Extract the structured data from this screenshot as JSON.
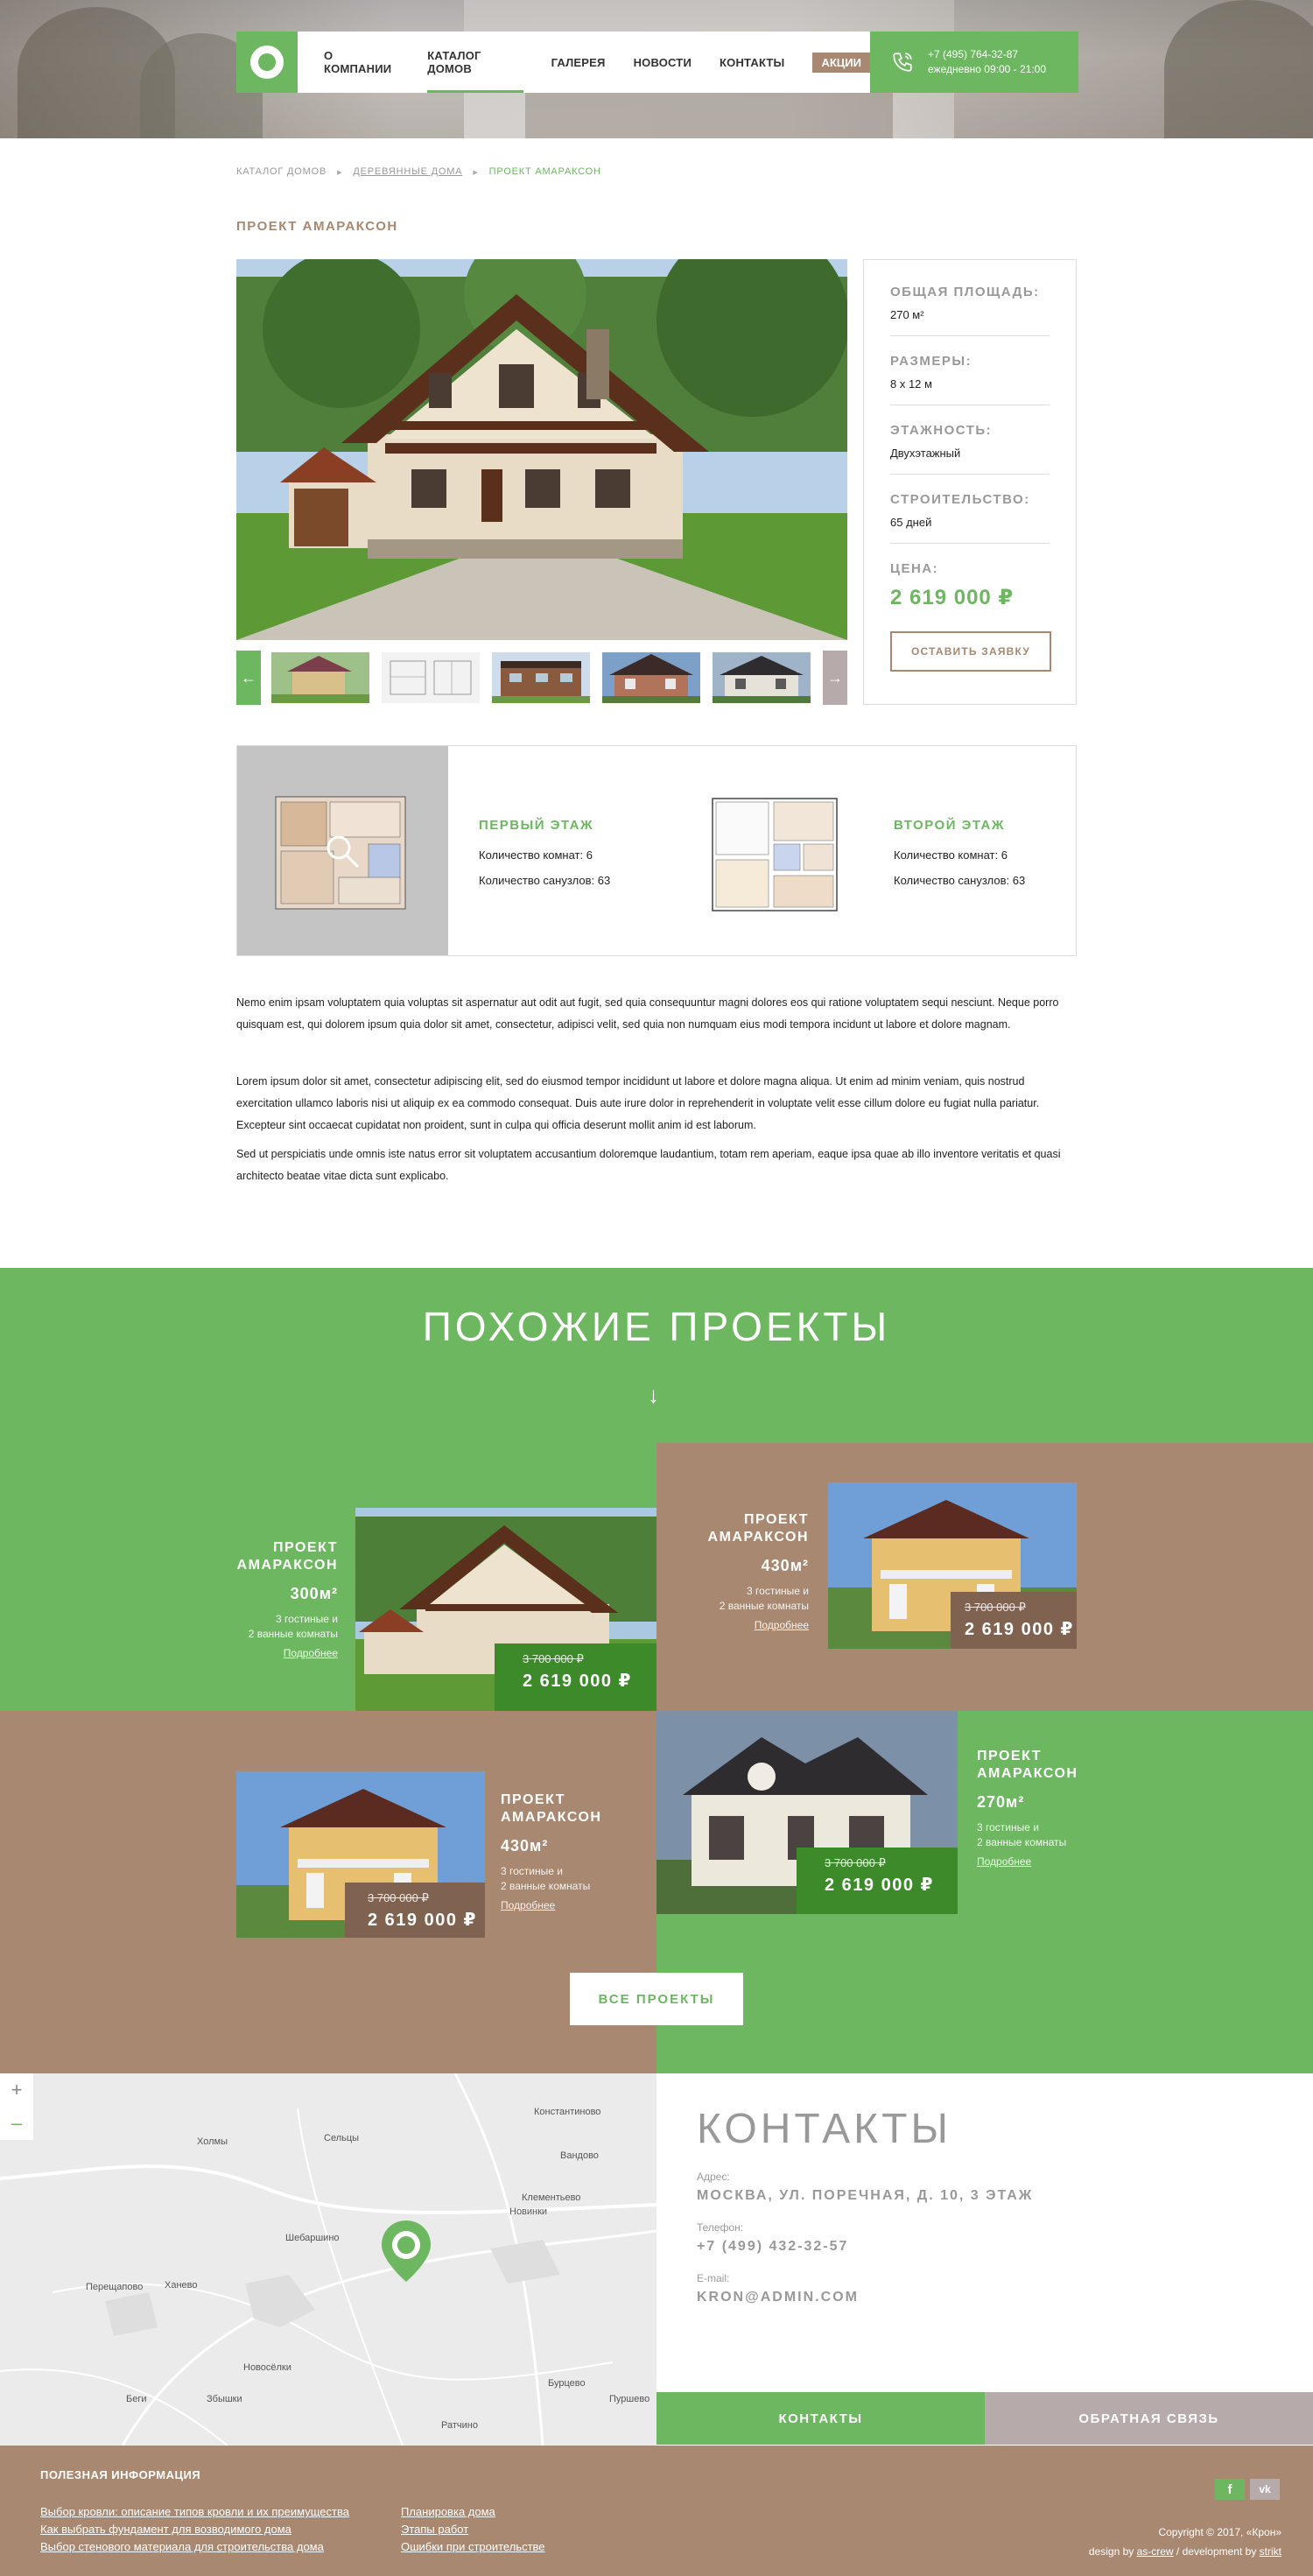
{
  "header": {
    "menu": [
      "О компании",
      "Каталог домов",
      "Галерея",
      "Новости",
      "Контакты"
    ],
    "promo": "Акции",
    "phone": "+7 (495) 764-32-87",
    "hours": "ежедневно 09:00 - 21:00"
  },
  "breadcrumb": {
    "items": [
      "Каталог домов",
      "Деревянные дома",
      "Проект Амараксон"
    ]
  },
  "project": {
    "title": "Проект Амараксон",
    "specs": [
      {
        "label": "Общая площадь:",
        "value": "270 м²"
      },
      {
        "label": "Размеры:",
        "value": "8 х 12 м"
      },
      {
        "label": "Этажность:",
        "value": "Двухэтажный"
      },
      {
        "label": "Строительство:",
        "value": "65 дней"
      }
    ],
    "price_label": "Цена:",
    "price": "2 619 000 ₽",
    "order_button": "Оставить заявку"
  },
  "plans": {
    "floor1": {
      "title": "Первый этаж",
      "rooms": "Количество комнат: 6",
      "baths": "Количество санузлов: 63"
    },
    "floor2": {
      "title": "Второй этаж",
      "rooms": "Количество комнат: 6",
      "baths": "Количество санузлов: 63"
    }
  },
  "description": [
    "Nemo enim ipsam voluptatem quia voluptas sit aspernatur aut odit aut fugit, sed quia consequuntur magni dolores eos qui ratione voluptatem sequi nesciunt. Neque porro quisquam est, qui dolorem ipsum quia dolor sit amet, consectetur, adipisci velit, sed quia non numquam eius modi tempora incidunt ut labore et dolore magnam.",
    "Lorem ipsum dolor sit amet, consectetur adipiscing elit, sed do eiusmod tempor incididunt ut labore et dolore magna aliqua. Ut enim ad minim veniam, quis nostrud exercitation ullamco laboris nisi ut aliquip ex ea commodo consequat. Duis aute irure dolor in reprehenderit in voluptate velit esse cillum dolore eu fugiat nulla pariatur. Excepteur sint occaecat cupidatat non proident, sunt in culpa qui officia deserunt mollit anim id est laborum.",
    "Sed ut perspiciatis unde omnis iste natus error sit voluptatem accusantium doloremque laudantium, totam rem aperiam, eaque ipsa quae ab illo inventore veritatis et quasi architecto beatae vitae dicta sunt explicabo."
  ],
  "similar": {
    "title": "Похожие проекты",
    "cards": [
      {
        "name1": "Проект",
        "name2": "Амараксон",
        "area": "300м²",
        "rooms1": "3 гостиные и",
        "rooms2": "2 ванные комнаты",
        "more": "Подробнее",
        "old_price": "3 700 000 ₽",
        "price": "2 619 000 ₽"
      },
      {
        "name1": "Проект",
        "name2": "Амараксон",
        "area": "430м²",
        "rooms1": "3 гостиные и",
        "rooms2": "2 ванные комнаты",
        "more": "Подробнее",
        "old_price": "3 700 000 ₽",
        "price": "2 619 000 ₽"
      },
      {
        "name1": "Проект",
        "name2": "Амараксон",
        "area": "430м²",
        "rooms1": "3 гостиные и",
        "rooms2": "2 ванные комнаты",
        "more": "Подробнее",
        "old_price": "3 700 000 ₽",
        "price": "2 619 000 ₽"
      },
      {
        "name1": "Проект",
        "name2": "Амараксон",
        "area": "270м²",
        "rooms1": "3 гостиные и",
        "rooms2": "2 ванные комнаты",
        "more": "Подробнее",
        "old_price": "3 700 000 ₽",
        "price": "2 619 000 ₽"
      }
    ],
    "all_button": "Все проекты"
  },
  "map": {
    "labels": [
      "Константиново",
      "Холмы",
      "Сельцы",
      "Вандово",
      "Клементьево",
      "Новинки",
      "Шебаршино",
      "Перещапово",
      "Ханево",
      "Новосёлки",
      "Беги",
      "Збышки",
      "Бурцево",
      "Ратчино",
      "Пуршево"
    ],
    "plus": "+",
    "minus": "–"
  },
  "contacts": {
    "title": "Контакты",
    "address_label": "Адрес:",
    "address": "Москва, ул. Поречная, д. 10, 3 этаж",
    "phone_label": "Телефон:",
    "phone": "+7 (499) 432-32-57",
    "email_label": "E-mail:",
    "email": "kron@admin.com",
    "btn_contacts": "Контакты",
    "btn_feedback": "Обратная связь"
  },
  "footer": {
    "heading": "Полезная информация",
    "col1": [
      "Выбор кровли: описание типов кровли и их преимущества",
      "Как выбрать фундамент для возводимого дома",
      "Выбор стенового материала для строительства дома"
    ],
    "col2": [
      "Планировка дома",
      "Этапы работ",
      "Ошибки при строительстве"
    ],
    "facebook": "f",
    "vk": "vk",
    "copyright": "Copyright ©  2017, «Крон»",
    "design_prefix": "design by ",
    "design_by": "as-crew",
    "dev_prefix": " / development by ",
    "dev_by": "strikt"
  },
  "colors": {
    "accent": "#6cb760",
    "brown": "#a88870",
    "grey": "#b7aaaa"
  }
}
